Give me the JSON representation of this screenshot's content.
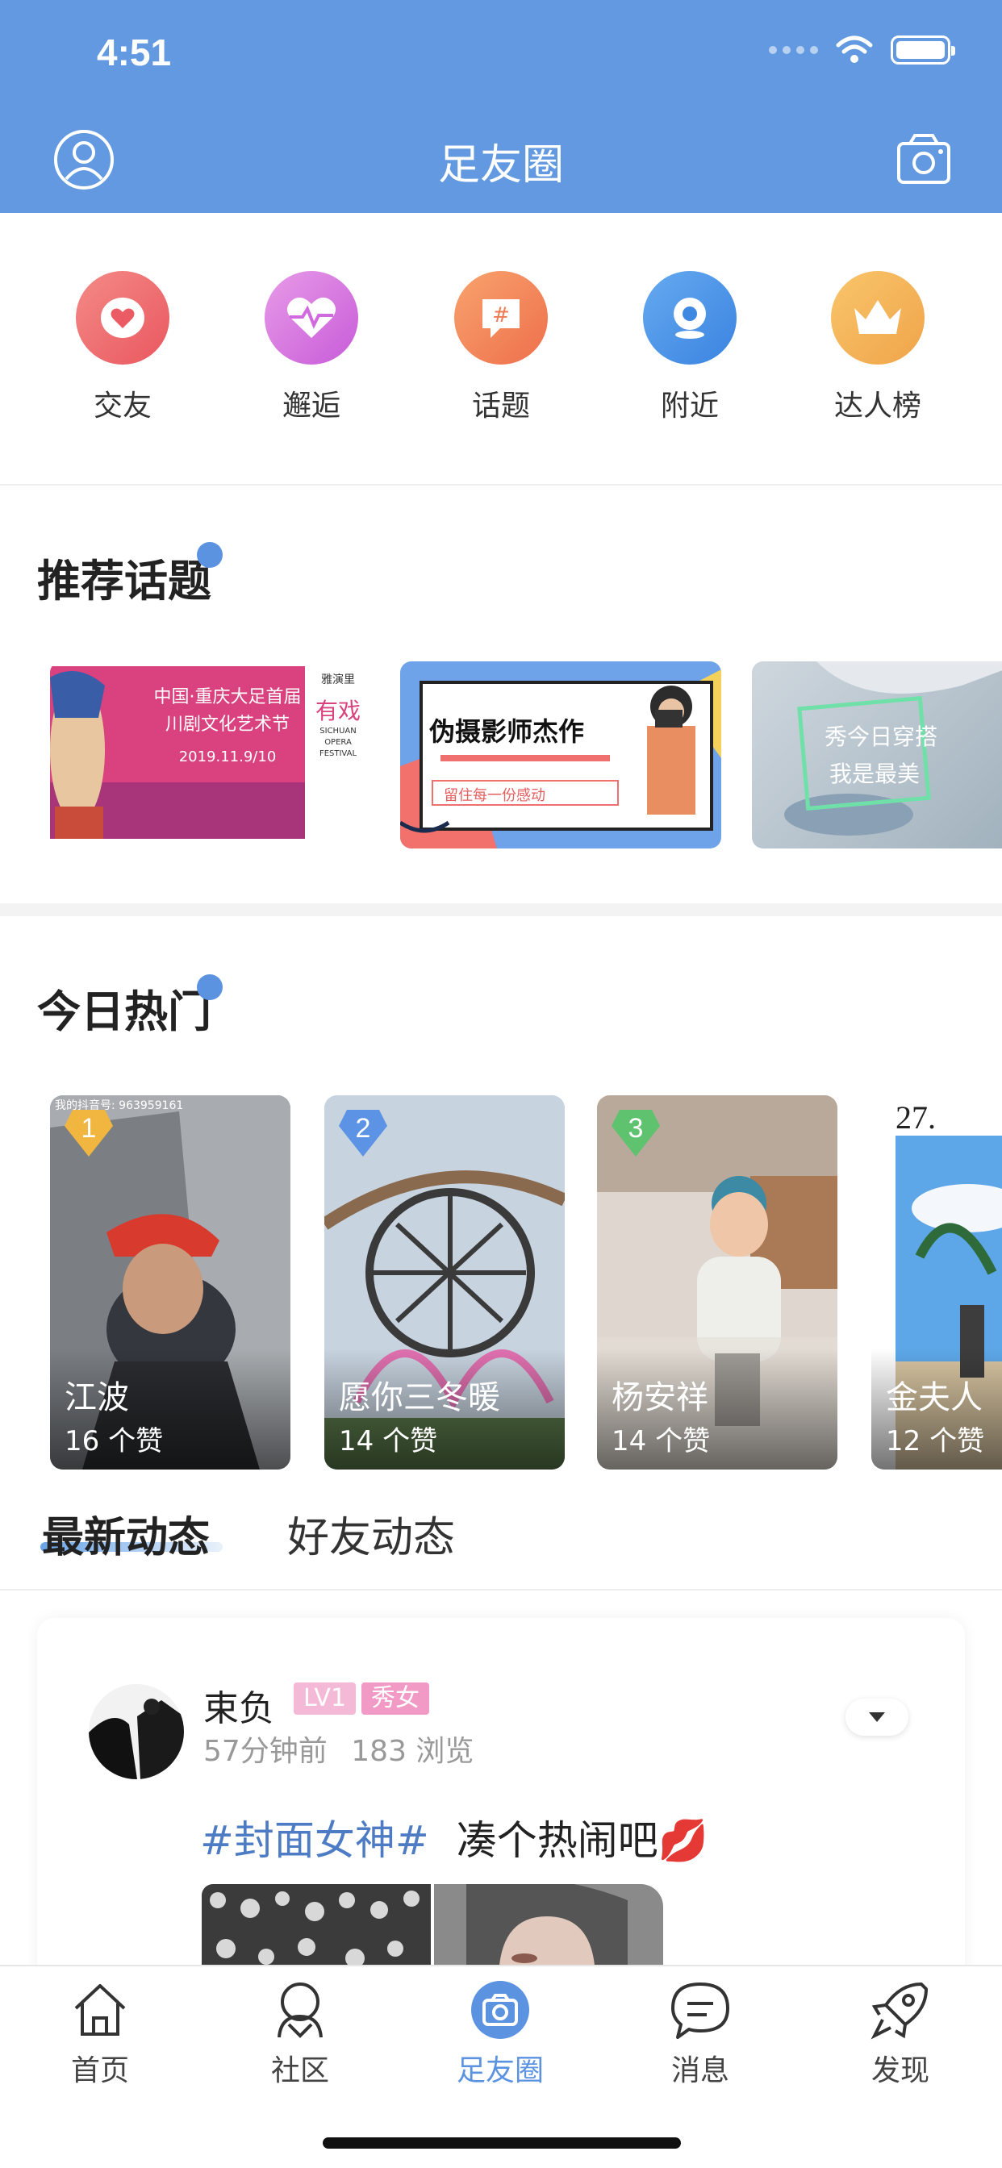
{
  "status": {
    "time": "4:51"
  },
  "header": {
    "title": "足友圈",
    "user_icon": "user-circle-icon",
    "camera_icon": "camera-icon"
  },
  "quick_entries": [
    {
      "label": "交友",
      "icon": "heart-icon",
      "color": "#ef6a6e"
    },
    {
      "label": "邂逅",
      "icon": "heartbeat-icon",
      "color": "#d36be0"
    },
    {
      "label": "话题",
      "icon": "hashtag-icon",
      "color": "#f2855d"
    },
    {
      "label": "附近",
      "icon": "location-icon",
      "color": "#4c93e6"
    },
    {
      "label": "达人榜",
      "icon": "crown-icon",
      "color": "#f2b45a"
    }
  ],
  "recommended": {
    "title": "推荐话题",
    "topics": [
      {
        "title": "中国·重庆大足首届川剧文化艺术节",
        "date": "2019.11.9/10",
        "brand": "有戏",
        "sub": "SICHUAN OPERA FESTIVAL",
        "logo": "雅演里"
      },
      {
        "title": "伪摄影师杰作",
        "subtitle": "留住每一份感动"
      },
      {
        "title": "秀今日穿搭",
        "subtitle": "我是最美"
      }
    ]
  },
  "hot": {
    "title": "今日热门",
    "items": [
      {
        "rank": "1",
        "name": "江波",
        "likes": "16 个赞",
        "watermark": "我的抖音号: 963959161"
      },
      {
        "rank": "2",
        "name": "愿你三冬暖",
        "likes": "14 个赞"
      },
      {
        "rank": "3",
        "name": "杨安祥",
        "likes": "14 个赞"
      },
      {
        "rank": "",
        "name": "金夫人",
        "likes": "12 个赞",
        "number": "27."
      }
    ]
  },
  "feed_tabs": {
    "active": "最新动态",
    "other": "好友动态"
  },
  "post": {
    "author": "束负",
    "level": "LV1",
    "tag": "秀女",
    "time": "57分钟前",
    "views": "183 浏览",
    "hashtag": "#封面女神#",
    "text": "凑个热闹吧",
    "emoji": "💋"
  },
  "tabbar": [
    {
      "label": "首页",
      "icon": "home-icon",
      "active": false
    },
    {
      "label": "社区",
      "icon": "community-icon",
      "active": false
    },
    {
      "label": "足友圈",
      "icon": "circle-camera-icon",
      "active": true
    },
    {
      "label": "消息",
      "icon": "message-icon",
      "active": false
    },
    {
      "label": "发现",
      "icon": "rocket-icon",
      "active": false
    }
  ],
  "colors": {
    "primary": "#6299e0",
    "hashtag": "#4d7cc4",
    "level_badge": "#f5b9d8",
    "tag_badge": "#f29ac6"
  }
}
